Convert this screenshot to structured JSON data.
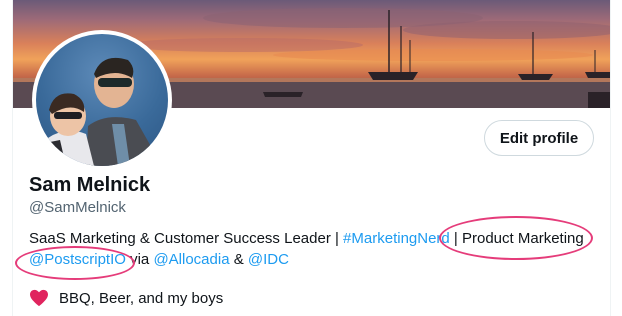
{
  "profile": {
    "name": "Sam Melnick",
    "handle": "@SamMelnick",
    "edit_button": "Edit profile"
  },
  "bio": {
    "line1": [
      {
        "text": "SaaS Marketing & Customer Success Leader | ",
        "link": false
      },
      {
        "text": "#MarketingNerd",
        "link": true
      },
      {
        "text": " | Product Marketing",
        "link": false
      }
    ],
    "line2": [
      {
        "text": "@PostscriptIO",
        "link": true
      },
      {
        "text": " via ",
        "link": false
      },
      {
        "text": "@Allocadia",
        "link": true
      },
      {
        "text": " & ",
        "link": false
      },
      {
        "text": "@IDC",
        "link": true
      }
    ]
  },
  "location": {
    "icon": "heart-icon",
    "text": "BBQ, Beer, and my boys"
  },
  "colors": {
    "link": "#1d9bf0",
    "annotation": "#e53c7a",
    "heart": "#e0245e"
  }
}
